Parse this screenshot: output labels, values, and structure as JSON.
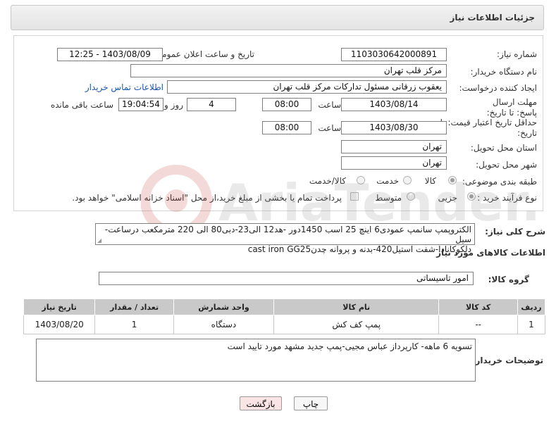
{
  "header": {
    "title": "جزئیات اطلاعات نیاز"
  },
  "form": {
    "need_number_label": "شماره نیاز:",
    "need_number": "1103030642000891",
    "announce_label": "تاریخ و ساعت اعلان عمومی:",
    "announce_value": "1403/08/09 - 12:25",
    "buyer_org_label": "نام دستگاه خریدار:",
    "buyer_org": "مرکز قلب تهران",
    "creator_label": "ایجاد کننده درخواست:",
    "creator": "یعقوب زرقانی مسئول تداركات مركز قلب تهران",
    "contact_link": "اطلاعات تماس خریدار",
    "reply_deadline_label": "مهلت ارسال پاسخ: تا تاریخ:",
    "reply_date": "1403/08/14",
    "time_label": "ساعت",
    "reply_time": "08:00",
    "days_value": "4",
    "days_label": "روز و",
    "remaining_time": "19:04:54",
    "remaining_label": "ساعت باقی مانده",
    "price_validity_label": "حداقل تاریخ اعتبار قیمت: تا تاریخ:",
    "price_date": "1403/08/30",
    "price_time": "08:00",
    "province_label": "استان محل تحویل:",
    "province": "تهران",
    "city_label": "شهر محل تحویل:",
    "city": "تهران",
    "category_label": "طبقه بندی موضوعی:",
    "category_options": [
      "کالا",
      "خدمت",
      "کالا/خدمت"
    ],
    "category_selected": "کالا",
    "process_label": "نوع فرآیند خرید :",
    "process_options": [
      "جزیی",
      "متوسط"
    ],
    "process_selected": "جزیی",
    "payment_note": "پرداخت تمام یا بخشی از مبلغ خرید،از محل \"اسناد خزانه اسلامی\" خواهد بود."
  },
  "description": {
    "label": "شرح کلی نیاز:",
    "line1": "الکتروپمپ سانمپ عمودی6 اینچ 25 اسب 1450دور -هد12 الی23-دبی80 الی 220 مترمکعب درساعت-سیل",
    "line2": "دلکوکانادا-شفت استیل420-بدنه و پروانه چدنcast iron GG25"
  },
  "goods": {
    "section_title": "اطلاعات کالاهای مورد نیاز",
    "group_label": "گروه کالا:",
    "group_value": "امور تاسیساتی",
    "columns": [
      "ردیف",
      "کد کالا",
      "نام کالا",
      "واحد شمارش",
      "تعداد / مقدار",
      "تاریخ نیاز"
    ],
    "rows": [
      [
        "1",
        "--",
        "پمپ کف کش",
        "دستگاه",
        "1",
        "1403/08/20"
      ]
    ]
  },
  "buyer_notes": {
    "label": "توضیحات خریدار:",
    "text": "تسویه 6 ماهه- کارپرداز عباس مجیی-پمپ جدید مشهد مورد تایید است"
  },
  "buttons": {
    "print": "چاپ",
    "back": "بازگشت"
  },
  "watermark_text": "AriaTender.neT"
}
